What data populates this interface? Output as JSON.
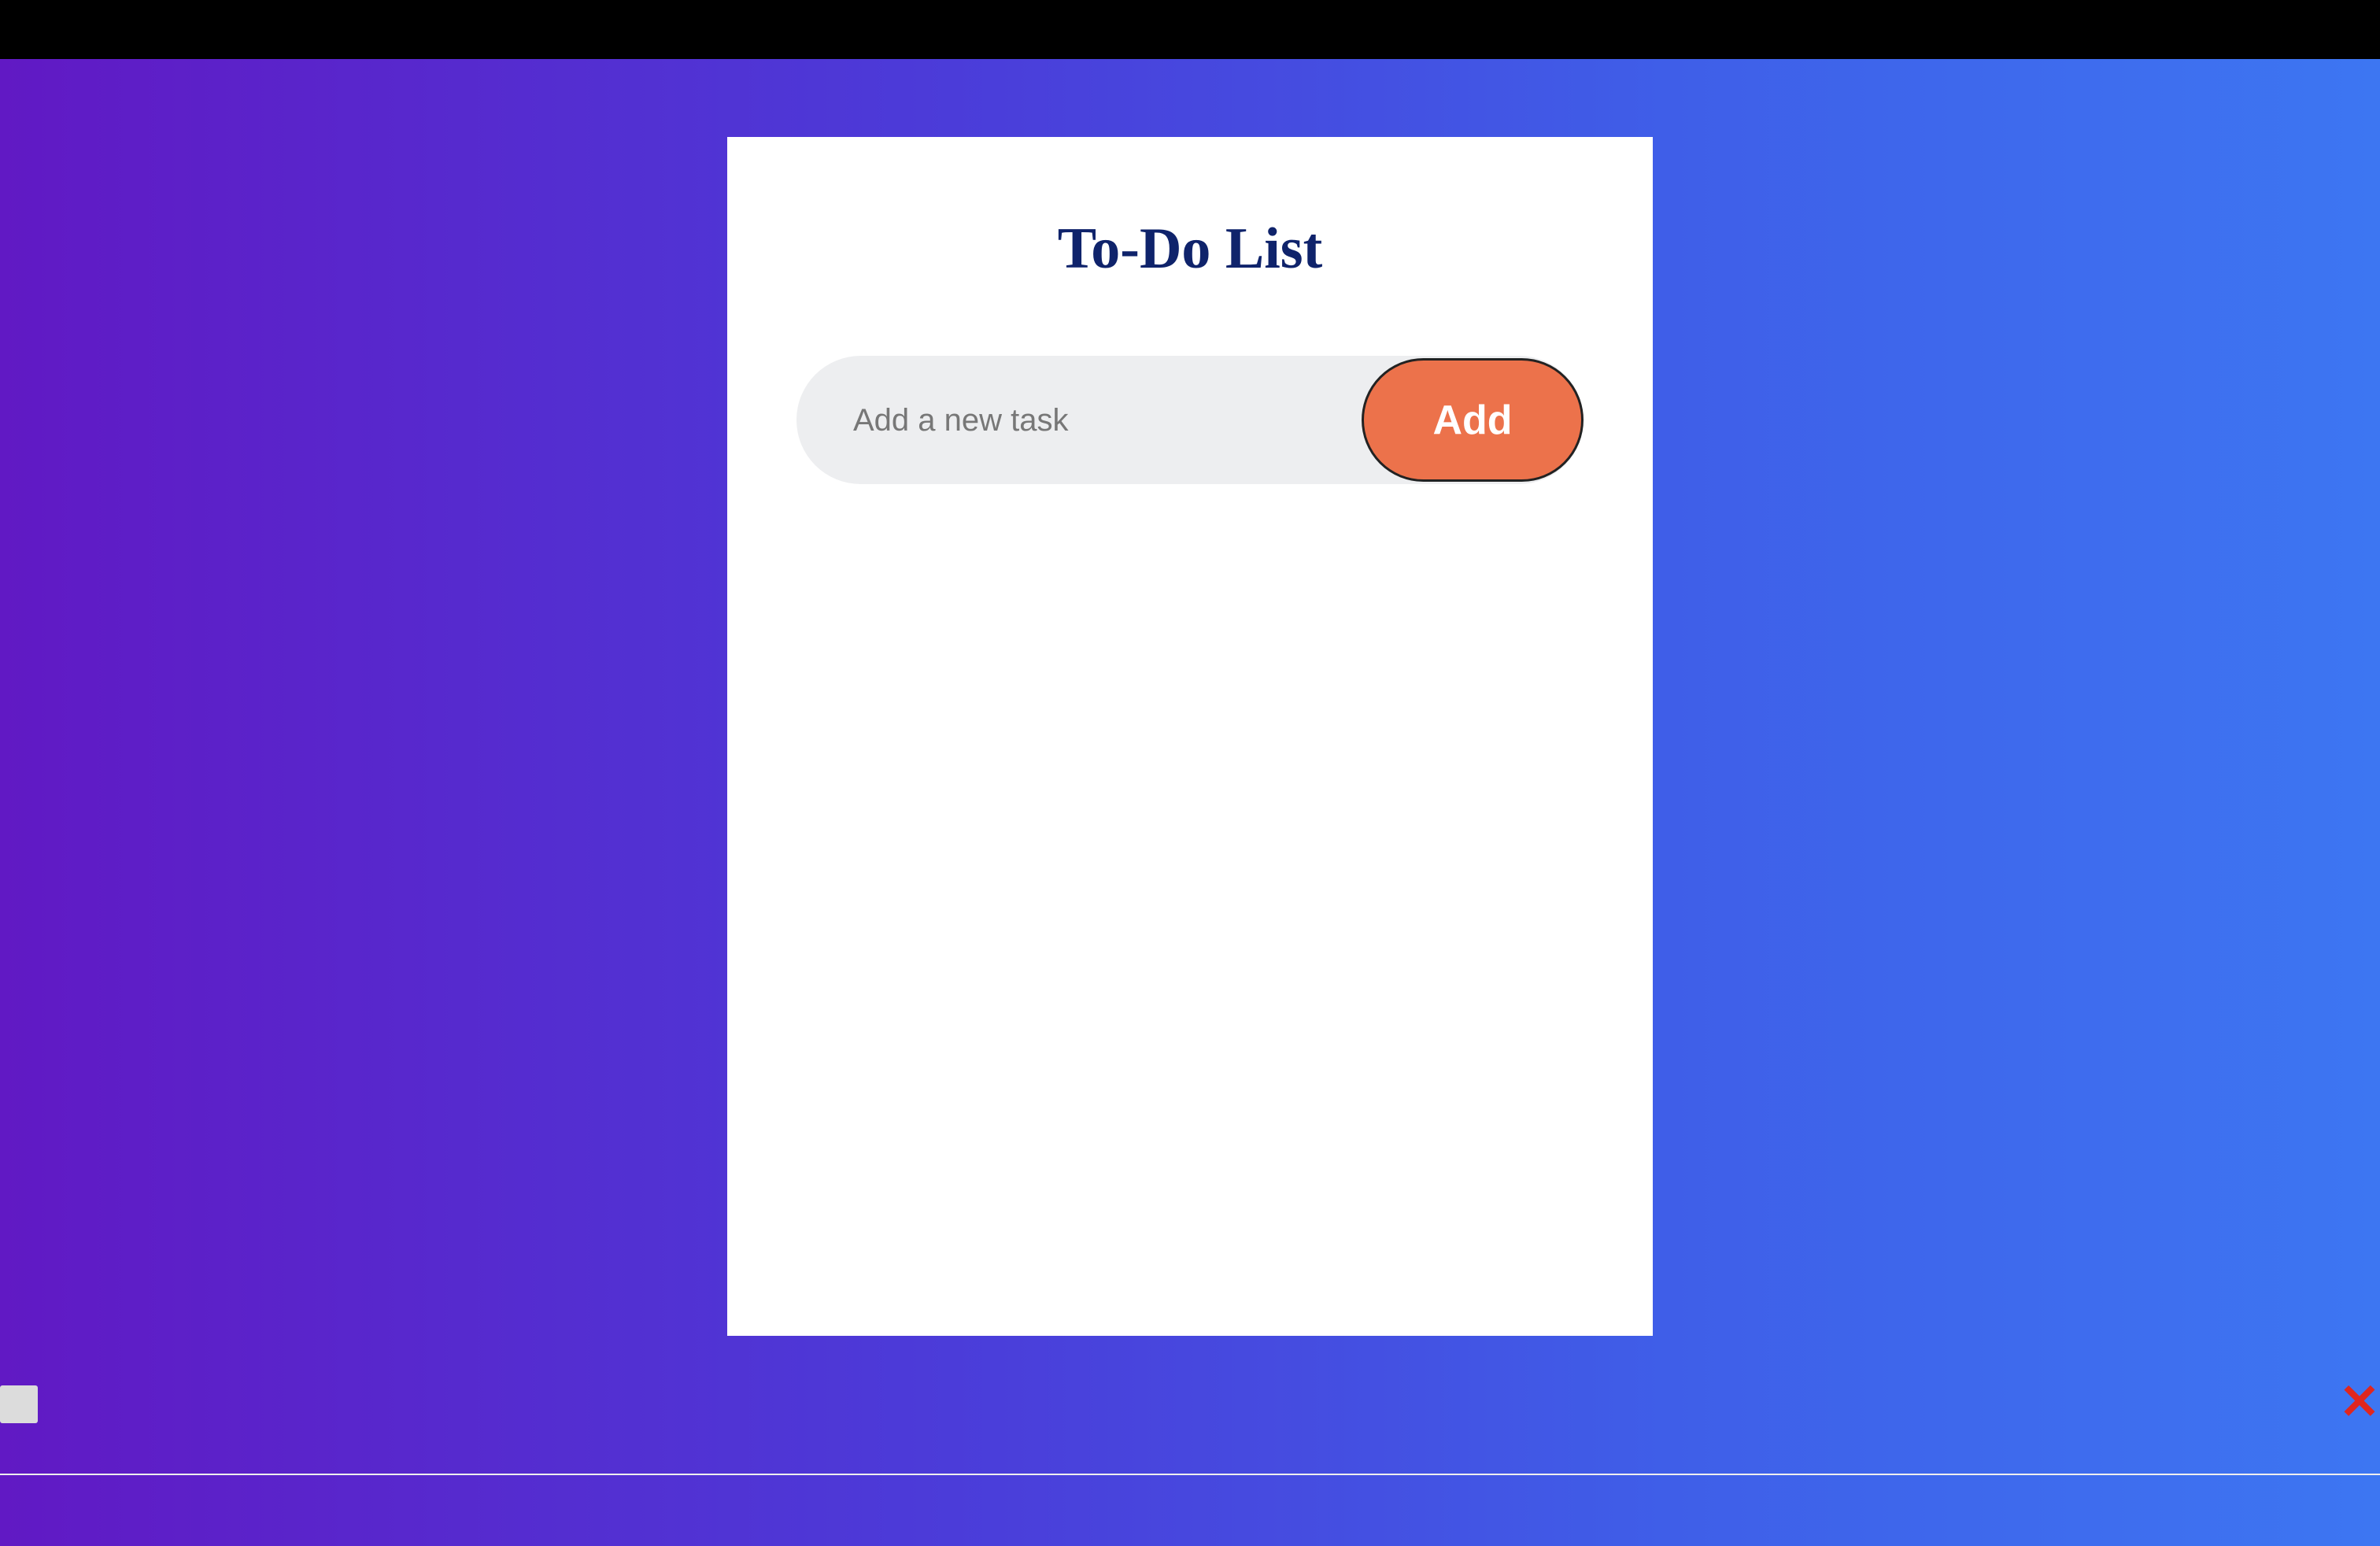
{
  "app": {
    "title": "To-Do List"
  },
  "form": {
    "input_placeholder": "Add a new task",
    "input_value": "",
    "add_label": "Add"
  },
  "tasks": [
    {
      "text": "",
      "checked": false,
      "delete_icon": "✕"
    }
  ],
  "colors": {
    "gradient_start": "#6119c4",
    "gradient_end": "#3d76f2",
    "add_button": "#ec724b",
    "title": "#0f236b",
    "delete": "#e0261e"
  }
}
